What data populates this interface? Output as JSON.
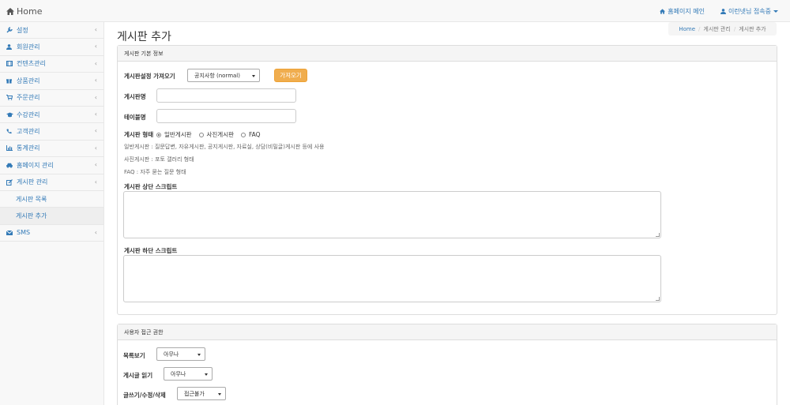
{
  "navbar": {
    "brand": "Home",
    "homepage_main": "홈페이지 메인",
    "user_status": "이런넷님 접속중"
  },
  "sidebar": {
    "items": [
      {
        "label": "설정"
      },
      {
        "label": "회원관리"
      },
      {
        "label": "컨텐츠관리"
      },
      {
        "label": "상품관리"
      },
      {
        "label": "주문관리"
      },
      {
        "label": "수강관리"
      },
      {
        "label": "고객관리"
      },
      {
        "label": "통계관리"
      },
      {
        "label": "홈페이지 관리"
      },
      {
        "label": "게시판 관리"
      }
    ],
    "subitems": [
      {
        "label": "게시판 목록"
      },
      {
        "label": "게시판 추가"
      }
    ],
    "last_item": {
      "label": "SMS"
    },
    "arrow": "‹"
  },
  "page": {
    "title": "게시판 추가"
  },
  "breadcrumb": {
    "home": "Home",
    "level1": "게시판 관리",
    "level2": "게시판 추가",
    "sep": "/"
  },
  "panel_basic": {
    "heading": "게시판 기본 정보",
    "load_label": "게시판설정 가져오기",
    "load_select": "공지사항 (normal)",
    "load_button": "가져오기",
    "name_label": "게시판명",
    "name_value": "",
    "table_label": "테이블명",
    "table_value": "",
    "type_label": "게시판 형태",
    "type_options": [
      "일반게시판",
      "사진게시판",
      "FAQ"
    ],
    "type_selected": "일반게시판",
    "desc": [
      "일반게시판 : 질문답변, 자유게시판, 공지게시판, 자료실, 상담(비밀글)게시판 등에 사용",
      "사진게시판 : 포토 갤러리 형태",
      "FAQ : 자주 묻는 질문 형태"
    ],
    "top_script_label": "게시판 상단 스크립트",
    "bottom_script_label": "게시판 하단 스크립트"
  },
  "panel_access": {
    "heading": "사용자 접근 권한",
    "list_label": "목록보기",
    "list_value": "아무나",
    "read_label": "게시글 읽기",
    "read_value": "아무나",
    "write_label": "글쓰기/수정/삭제",
    "write_value": "접근불가"
  }
}
